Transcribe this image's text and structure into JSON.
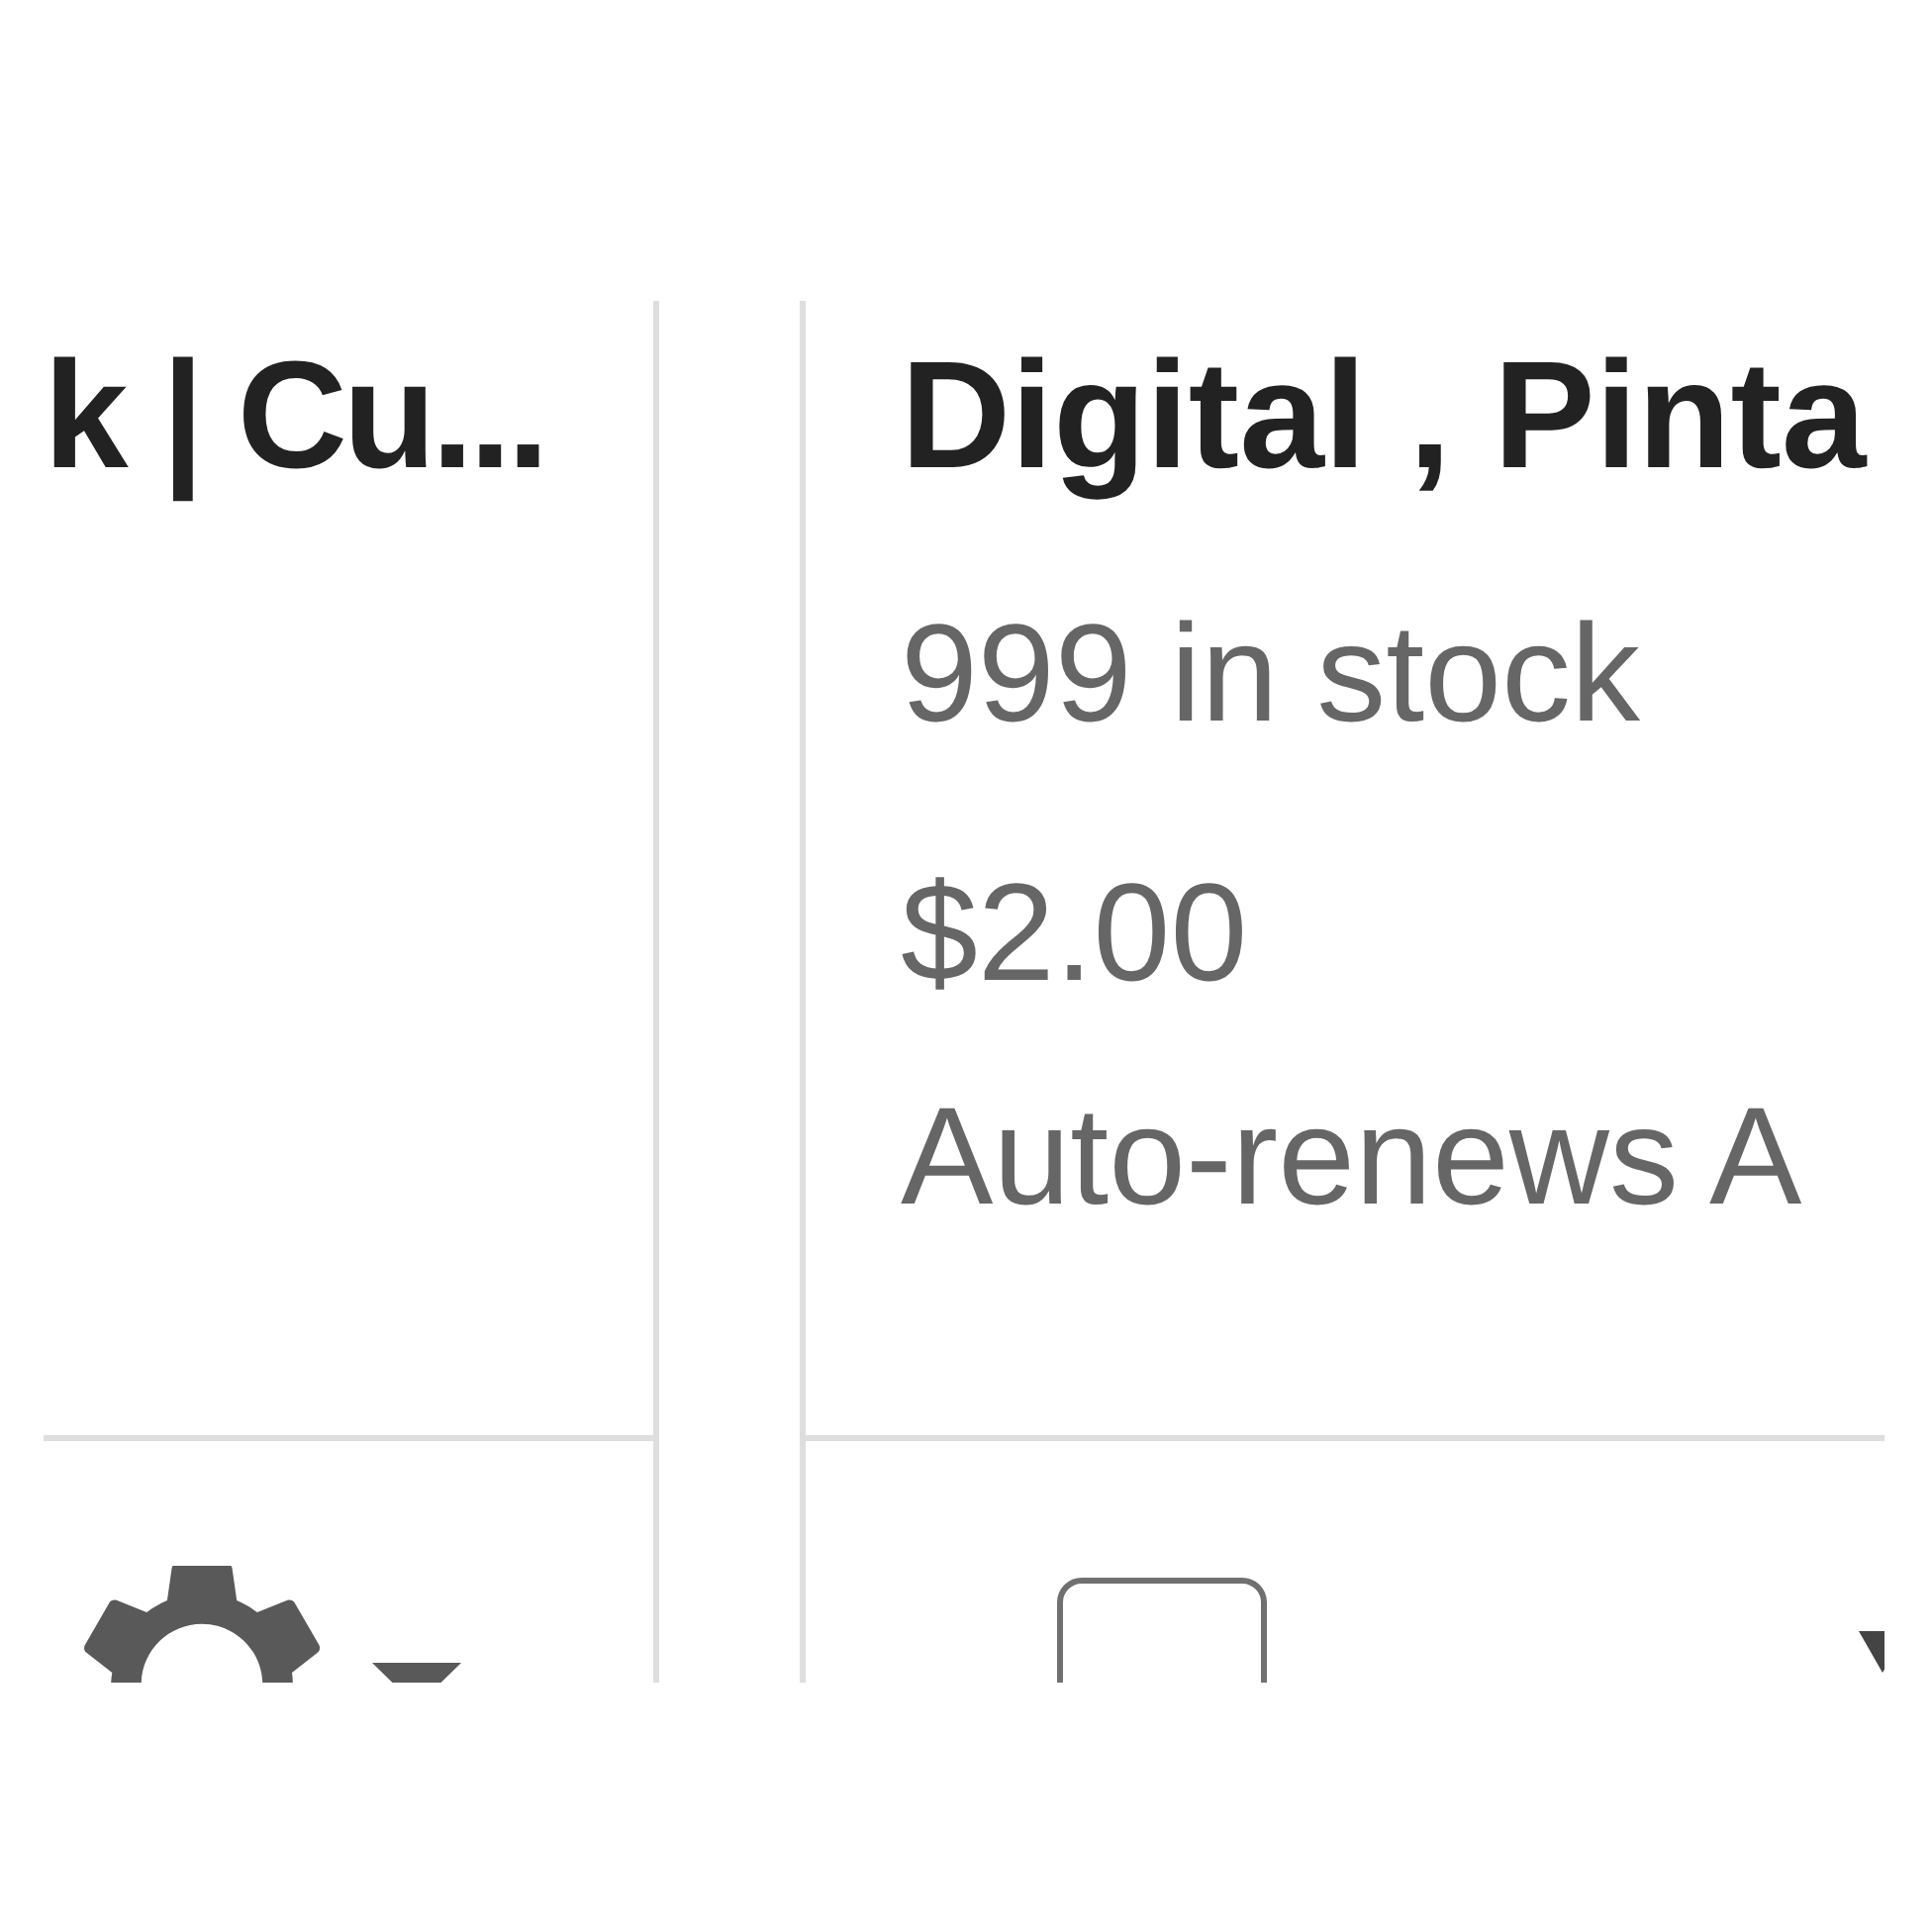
{
  "listings": [
    {
      "title": "k | Cu...",
      "controls": [
        {
          "kind": "settings_menu"
        }
      ]
    },
    {
      "title": "Digital , Pinta",
      "stock": "999 in stock",
      "price": "$2.00",
      "renewal": "Auto-renews A",
      "controls": [
        {
          "kind": "checkbox",
          "checked": false
        },
        {
          "kind": "dropdown"
        }
      ]
    }
  ]
}
